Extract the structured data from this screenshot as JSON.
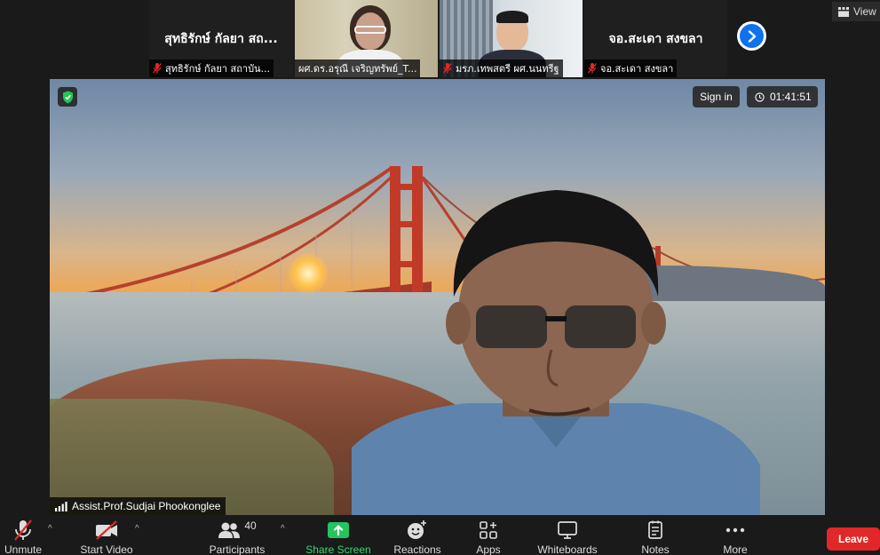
{
  "gallery": {
    "tiles": [
      {
        "id": "t1",
        "display_name": "สุทธิรักษ์ กัลยา สถ...",
        "label": "สุทธิรักษ์ กัลยา สถาบัน...",
        "has_video": false
      },
      {
        "id": "t2",
        "label": "ผศ.ดร.อรุณี เจริญทรัพย์_T...",
        "has_video": true
      },
      {
        "id": "t3",
        "label": "มรภ.เทพสตรี ผศ.นนทรีฐ",
        "has_video": true
      },
      {
        "id": "t4",
        "display_name": "จอ.สะเดา สงขลา",
        "label": "จอ.สะเดา สงขลา",
        "has_video": false
      }
    ],
    "next_icon": "chevron-right-icon"
  },
  "view_button": {
    "label": "View"
  },
  "main_video": {
    "sign_in_label": "Sign in",
    "timer": "01:41:51",
    "speaker_name": "Assist.Prof.Sudjai Phookonglee"
  },
  "toolbar": {
    "unmute_label": "Unmute",
    "start_video_label": "Start Video",
    "participants_label": "Participants",
    "participants_count": "40",
    "share_screen_label": "Share Screen",
    "reactions_label": "Reactions",
    "apps_label": "Apps",
    "whiteboards_label": "Whiteboards",
    "notes_label": "Notes",
    "more_label": "More",
    "leave_label": "Leave"
  },
  "colors": {
    "accent_blue": "#0e72ed",
    "share_green": "#2ddc6a",
    "leave_red": "#e02828",
    "mute_red": "#e02828"
  }
}
